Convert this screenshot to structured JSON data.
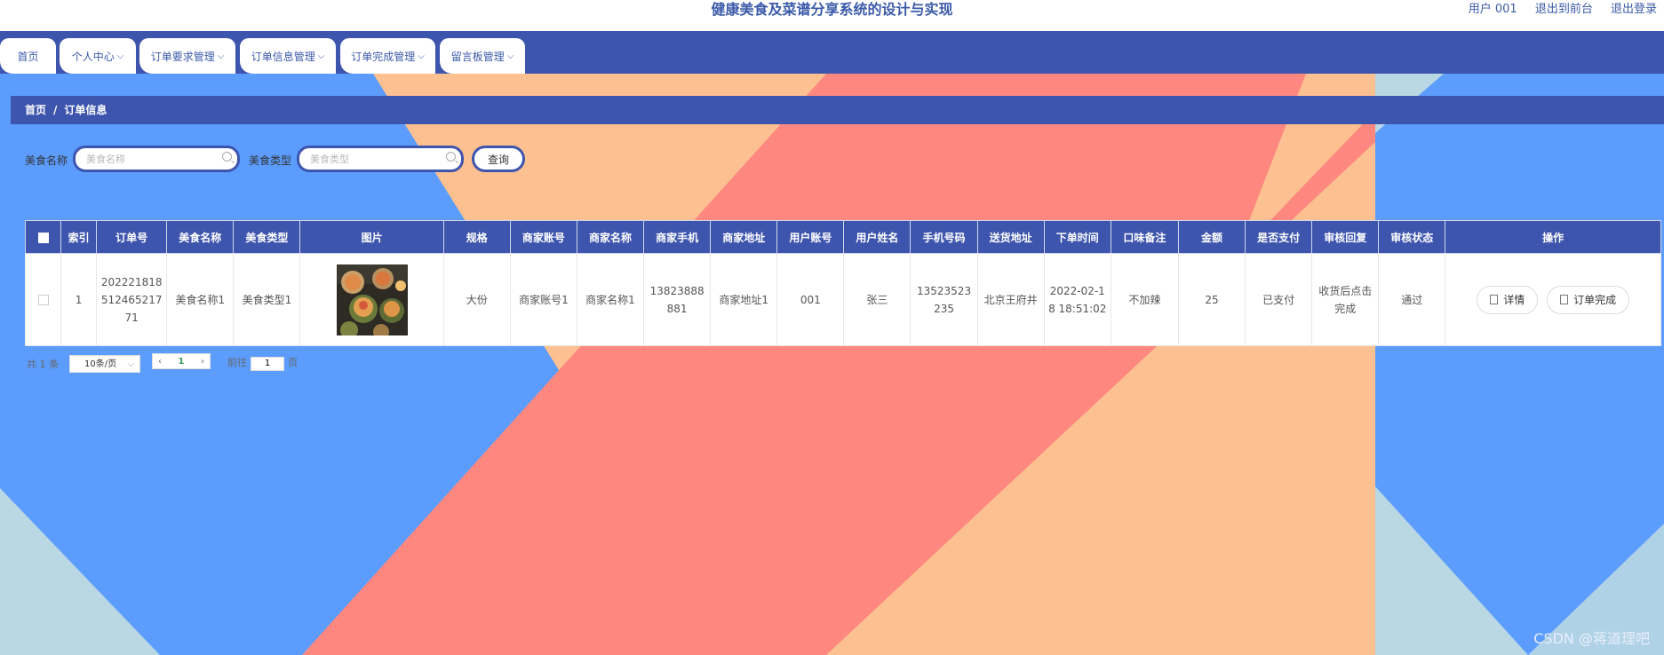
{
  "header": {
    "title": "健康美食及菜谱分享系统的设计与实现",
    "user": "用户 001",
    "back_to_front": "退出到前台",
    "logout": "退出登录"
  },
  "nav": {
    "items": [
      {
        "label": "首页"
      },
      {
        "label": "个人中心"
      },
      {
        "label": "订单要求管理"
      },
      {
        "label": "订单信息管理"
      },
      {
        "label": "订单完成管理"
      },
      {
        "label": "留言板管理"
      }
    ]
  },
  "breadcrumb": {
    "home": "首页",
    "sep": "/",
    "current": "订单信息"
  },
  "search": {
    "name_label": "美食名称",
    "name_placeholder": "美食名称",
    "type_label": "美食类型",
    "type_placeholder": "美食类型",
    "query_button": "查询"
  },
  "table": {
    "columns": [
      "索引",
      "订单号",
      "美食名称",
      "美食类型",
      "图片",
      "规格",
      "商家账号",
      "商家名称",
      "商家手机",
      "商家地址",
      "用户账号",
      "用户姓名",
      "手机号码",
      "送货地址",
      "下单时间",
      "口味备注",
      "金额",
      "是否支付",
      "审核回复",
      "审核状态",
      "操作"
    ],
    "rows": [
      {
        "index": "1",
        "order_no": "20222181851246521771",
        "food_name": "美食名称1",
        "food_type": "美食类型1",
        "spec": "大份",
        "merchant_account": "商家账号1",
        "merchant_name": "商家名称1",
        "merchant_phone": "13823888881",
        "merchant_address": "商家地址1",
        "user_account": "001",
        "user_name": "张三",
        "phone": "13523523235",
        "address": "北京王府井",
        "order_time": "2022-02-18 18:51:02",
        "taste_note": "不加辣",
        "amount": "25",
        "paid": "已支付",
        "review_reply": "收货后点击完成",
        "review_status": "通过",
        "detail_button": "详情",
        "complete_button": "订单完成"
      }
    ]
  },
  "pager": {
    "total": "共 1 条",
    "page_size": "10条/页",
    "current_page": "1",
    "goto_prefix": "前往",
    "goto_value": "1",
    "goto_suffix": "页"
  },
  "watermark": "CSDN @蒋道理吧",
  "colors": {
    "primary": "#3e55ad",
    "bg_blue": "#5b9cfc",
    "bg_salmon": "#fe887f",
    "bg_peach": "#fdc091",
    "bg_lightblue": "#b9d8e4"
  }
}
